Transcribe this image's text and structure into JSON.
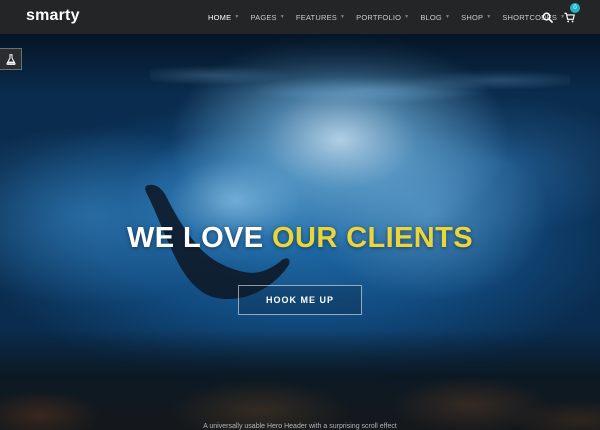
{
  "brand": {
    "logo_text": "smarty"
  },
  "nav": {
    "items": [
      {
        "label": "HOME",
        "active": true
      },
      {
        "label": "PAGES",
        "active": false
      },
      {
        "label": "FEATURES",
        "active": false
      },
      {
        "label": "PORTFOLIO",
        "active": false
      },
      {
        "label": "BLOG",
        "active": false
      },
      {
        "label": "SHOP",
        "active": false
      },
      {
        "label": "SHORTCODES",
        "active": false
      }
    ],
    "search_icon": "search-icon",
    "cart_icon": "cart-icon",
    "cart_count": "0"
  },
  "side_tab": {
    "icon": "flask-icon"
  },
  "hero": {
    "headline_white": "WE LOVE",
    "headline_yellow": "OUR CLIENTS",
    "cta_label": "HOOK ME UP",
    "subtext": "A universally usable Hero Header with a surprising scroll effect"
  },
  "colors": {
    "nav_bg": "#232527",
    "accent_yellow": "#e8d63a",
    "badge": "#1fb5c9"
  }
}
